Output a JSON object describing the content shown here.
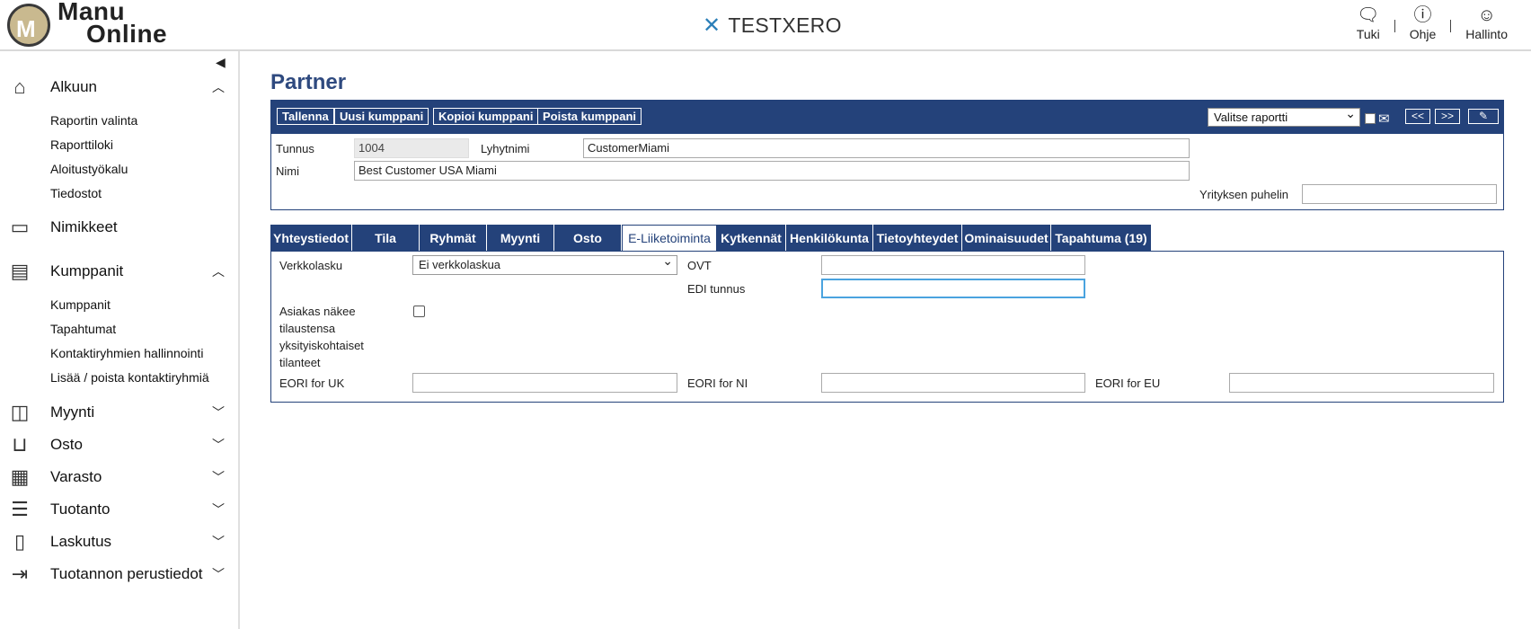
{
  "header": {
    "logo_line1": "Manu",
    "logo_line2": "Online",
    "logo_mark": "M",
    "environment": "TESTXERO",
    "links": [
      {
        "label": "Tuki",
        "icon": "chat-icon"
      },
      {
        "label": "Ohje",
        "icon": "help-icon"
      },
      {
        "label": "Hallinto",
        "icon": "user-icon"
      }
    ]
  },
  "sidebar": {
    "sections": [
      {
        "label": "Alkuun",
        "icon": "home-icon",
        "expanded": true,
        "items": [
          "Raportin valinta",
          "Raporttiloki",
          "Aloitustyökalu",
          "Tiedostot"
        ]
      },
      {
        "label": "Nimikkeet",
        "icon": "inbox-icon"
      },
      {
        "label": "Kumppanit",
        "icon": "contacts-icon",
        "expanded": true,
        "items": [
          "Kumppanit",
          "Tapahtumat",
          "Kontaktiryhmien hallinnointi",
          "Lisää / poista kontaktiryhmiä"
        ]
      },
      {
        "label": "Myynti",
        "icon": "wallet-icon"
      },
      {
        "label": "Osto",
        "icon": "basket-icon"
      },
      {
        "label": "Varasto",
        "icon": "warehouse-icon"
      },
      {
        "label": "Tuotanto",
        "icon": "database-icon"
      },
      {
        "label": "Laskutus",
        "icon": "document-icon"
      },
      {
        "label": "Tuotannon perustiedot",
        "icon": "exit-icon"
      }
    ]
  },
  "page": {
    "title": "Partner",
    "toolbar": {
      "save": "Tallenna",
      "new": "Uusi kumppani",
      "copy": "Kopioi kumppani",
      "delete": "Poista kumppani",
      "report_select": "Valitse raportti",
      "prev": "<<",
      "next": ">>",
      "attach": "✎"
    },
    "fields": {
      "id_label": "Tunnus",
      "id_value": "1004",
      "short_label": "Lyhytnimi",
      "short_value": "CustomerMiami",
      "name_label": "Nimi",
      "name_value": "Best Customer USA Miami",
      "phone_label": "Yrityksen puhelin",
      "phone_value": ""
    },
    "tabs": [
      "Yhteystiedot",
      "Tila",
      "Ryhmät",
      "Myynti",
      "Osto",
      "E-Liiketoiminta",
      "Kytkennät",
      "Henkilökunta",
      "Tietoyhteydet",
      "Ominaisuudet",
      "Tapahtuma (19)"
    ],
    "active_tab": "E-Liiketoiminta",
    "ebusiness": {
      "einvoice_label": "Verkkolasku",
      "einvoice_value": "Ei verkkolaskua",
      "ovt_label": "OVT",
      "ovt_value": "",
      "edi_label": "EDI tunnus",
      "edi_value": "",
      "customer_sees_label": "Asiakas näkee tilaustensa yksityiskohtaiset tilanteet",
      "customer_sees_checked": false,
      "eori_uk_label": "EORI for UK",
      "eori_ni_label": "EORI for NI",
      "eori_eu_label": "EORI for EU"
    }
  }
}
